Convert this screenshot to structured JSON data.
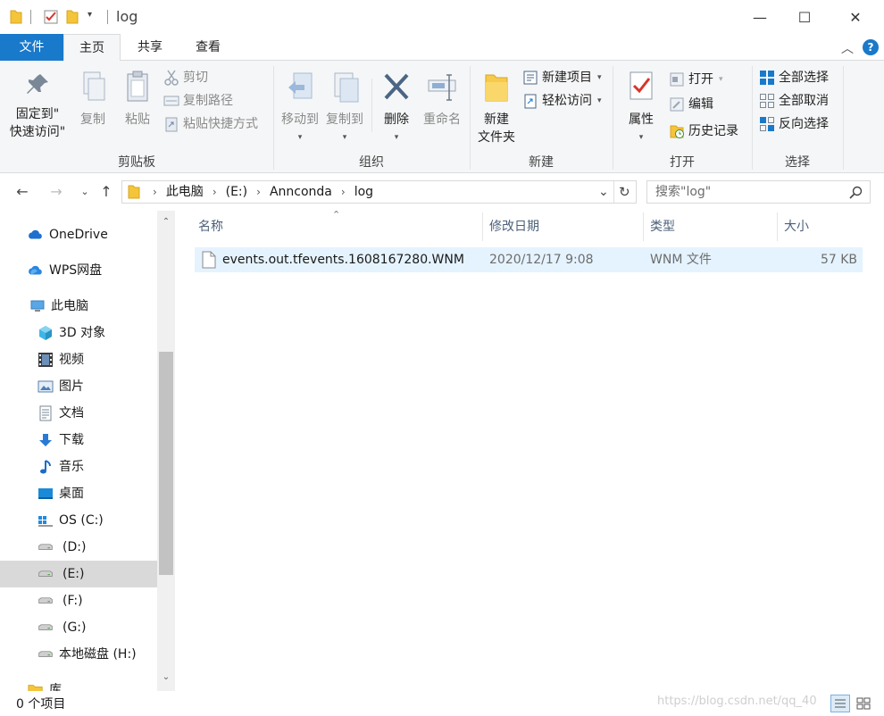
{
  "window": {
    "title": "log",
    "controls": {
      "minimize": "—",
      "maximize": "☐",
      "close": "✕"
    }
  },
  "ribbon_tabs": [
    {
      "label": "文件"
    },
    {
      "label": "主页"
    },
    {
      "label": "共享"
    },
    {
      "label": "查看"
    }
  ],
  "ribbon": {
    "clipboard": {
      "group_label": "剪贴板",
      "pin_line1": "固定到\"",
      "pin_line2": "快速访问\"",
      "copy": "复制",
      "paste": "粘贴",
      "cut": "剪切",
      "copy_path": "复制路径",
      "paste_shortcut": "粘贴快捷方式"
    },
    "organize": {
      "group_label": "组织",
      "move_to": "移动到",
      "copy_to": "复制到",
      "delete": "删除",
      "rename": "重命名"
    },
    "new": {
      "group_label": "新建",
      "new_folder_line1": "新建",
      "new_folder_line2": "文件夹",
      "new_item": "新建项目",
      "easy_access": "轻松访问"
    },
    "open": {
      "group_label": "打开",
      "properties": "属性",
      "open": "打开",
      "edit": "编辑",
      "history": "历史记录"
    },
    "select": {
      "group_label": "选择",
      "select_all": "全部选择",
      "select_none": "全部取消",
      "invert": "反向选择"
    }
  },
  "address": {
    "crumbs": [
      "此电脑",
      "(E:)",
      "Annconda",
      "log"
    ],
    "search_placeholder": "搜索\"log\""
  },
  "nav_pane": {
    "items": [
      {
        "label": "OneDrive",
        "icon": "cloud-icon"
      },
      {
        "label": "WPS网盘",
        "icon": "cloud-icon"
      },
      {
        "label": "此电脑",
        "icon": "computer-icon"
      },
      {
        "label": "3D 对象",
        "icon": "cube-icon"
      },
      {
        "label": "视频",
        "icon": "film-icon"
      },
      {
        "label": "图片",
        "icon": "picture-icon"
      },
      {
        "label": "文档",
        "icon": "document-icon"
      },
      {
        "label": "下载",
        "icon": "download-icon"
      },
      {
        "label": "音乐",
        "icon": "music-icon"
      },
      {
        "label": "桌面",
        "icon": "desktop-icon"
      },
      {
        "label": "OS (C:)",
        "icon": "windows-drive-icon"
      },
      {
        "label": "(D:)",
        "icon": "drive-icon"
      },
      {
        "label": "(E:)",
        "icon": "drive-icon",
        "selected": true
      },
      {
        "label": "(F:)",
        "icon": "drive-icon"
      },
      {
        "label": "(G:)",
        "icon": "drive-icon"
      },
      {
        "label": "本地磁盘 (H:)",
        "icon": "drive-icon"
      },
      {
        "label": "库",
        "icon": "folder-icon"
      }
    ]
  },
  "file_list": {
    "columns": [
      "名称",
      "修改日期",
      "类型",
      "大小"
    ],
    "rows": [
      {
        "name": "events.out.tfevents.1608167280.WNM",
        "modified": "2020/12/17 9:08",
        "type": "WNM 文件",
        "size": "57 KB"
      }
    ]
  },
  "status_bar": {
    "item_count": "0 个项目",
    "watermark": "https://blog.csdn.net/qq_40"
  },
  "colors": {
    "accent": "#1979ca",
    "ribbon_bg": "#f5f6f7",
    "selection": "#e5f3ff",
    "nav_selected": "#d9d9d9"
  }
}
